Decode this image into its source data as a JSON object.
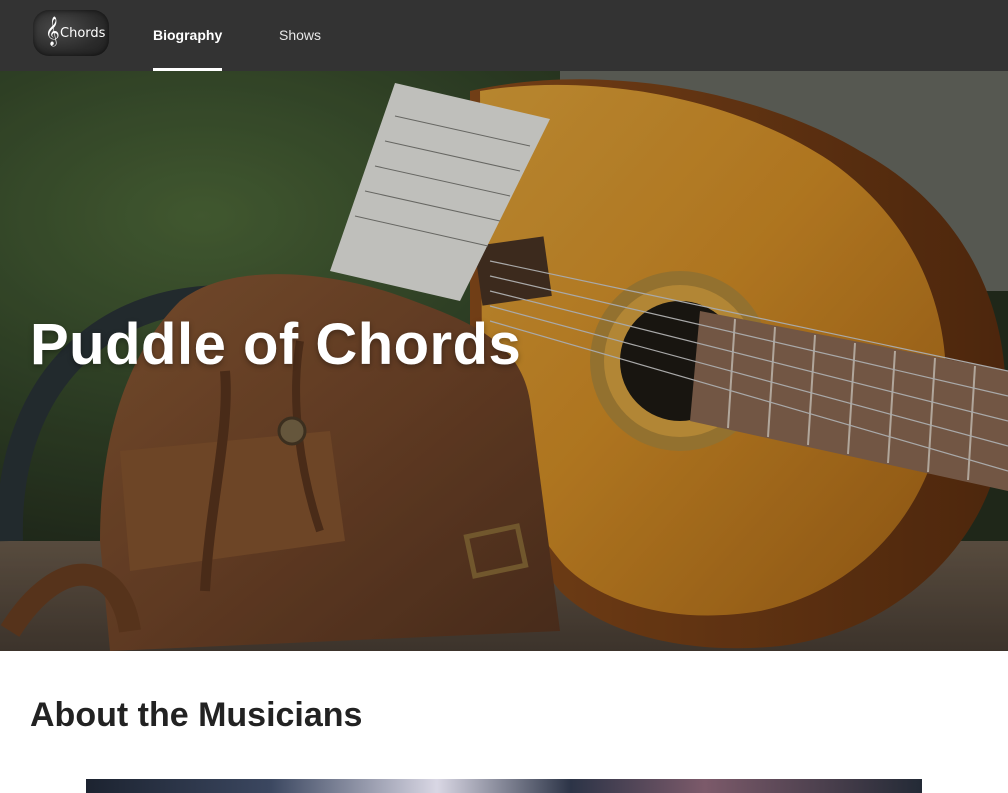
{
  "nav": {
    "logo": {
      "clef_glyph": "𝄞",
      "text": "Chords",
      "icon": "treble-clef-icon"
    },
    "links": [
      {
        "label": "Biography",
        "active": true
      },
      {
        "label": "Shows",
        "active": false
      }
    ]
  },
  "hero": {
    "title": "Puddle of Chords",
    "image_description": "acoustic-guitar-and-leather-backpack-photo"
  },
  "about": {
    "title": "About the Musicians"
  },
  "colors": {
    "nav_background": "#333333",
    "nav_text": "#ffffff",
    "heading_text": "#222222"
  }
}
